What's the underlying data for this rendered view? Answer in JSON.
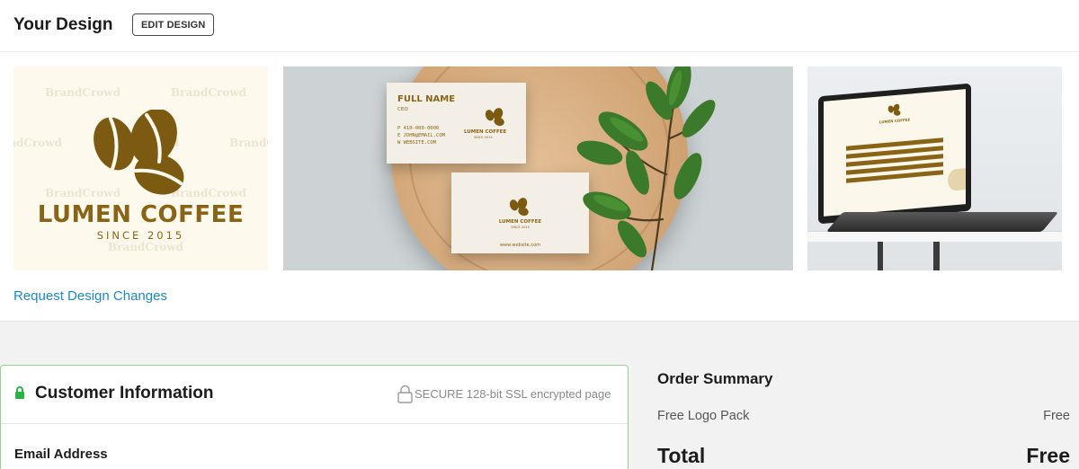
{
  "design": {
    "title": "Your Design",
    "edit_button": "EDIT DESIGN",
    "request_link": "Request Design Changes",
    "watermark": "BrandCrowd",
    "brand_name": "LUMEN COFFEE",
    "brand_since": "SINCE 2015",
    "card_full_name": "FULL NAME",
    "card_role": "CEO",
    "card_phone": "P 410-000-0000",
    "card_email": "E JOHN@EMAIL.COM",
    "card_website": "W WEBSITE.COM",
    "card_back_website": "www.website.com",
    "brand_color": "#8a6416"
  },
  "customer": {
    "title": "Customer Information",
    "secure_text": "SECURE 128-bit SSL encrypted page",
    "email_label": "Email Address",
    "accent_color": "#2bb34a"
  },
  "summary": {
    "title": "Order Summary",
    "item_label": "Free Logo Pack",
    "item_price": "Free",
    "total_label": "Total",
    "total_value": "Free"
  }
}
